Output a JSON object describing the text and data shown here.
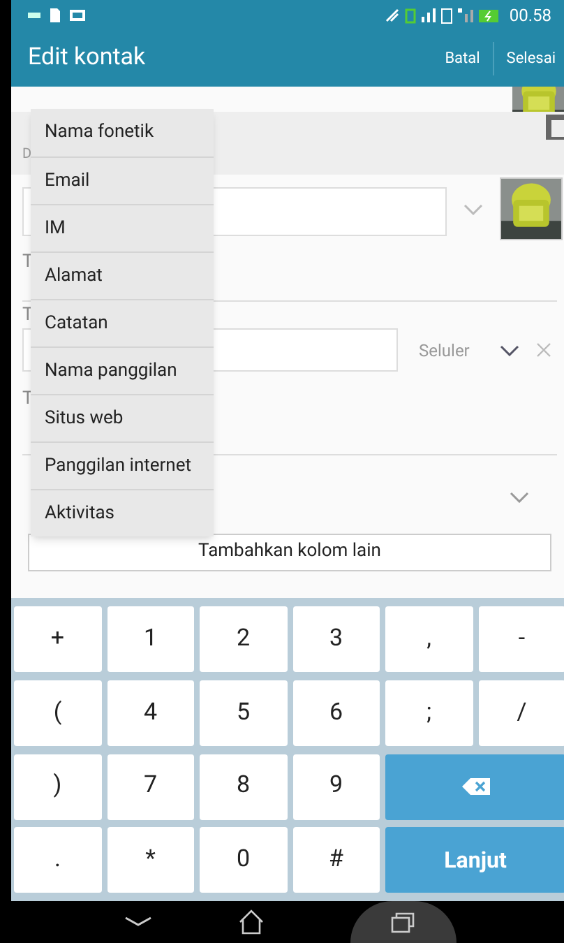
{
  "status_bar": {
    "time": "00.58"
  },
  "app_bar": {
    "title": "Edit kontak",
    "actions": [
      "Batal",
      "Selesai"
    ]
  },
  "form": {
    "name_sub": "D",
    "phone_type": "Seluler",
    "label_1": "T",
    "label_2": "T",
    "label_3": "T",
    "add_field_button": "Tambahkan kolom lain"
  },
  "menu": {
    "items": [
      "Nama fonetik",
      "Email",
      "IM",
      "Alamat",
      "Catatan",
      "Nama panggilan",
      "Situs web",
      "Panggilan internet",
      "Aktivitas"
    ]
  },
  "keyboard": {
    "keys": [
      {
        "label": "+",
        "kind": "char"
      },
      {
        "label": "1",
        "kind": "char"
      },
      {
        "label": "2",
        "kind": "char"
      },
      {
        "label": "3",
        "kind": "char"
      },
      {
        "label": ",",
        "kind": "char"
      },
      {
        "label": "-",
        "kind": "char"
      },
      {
        "label": "(",
        "kind": "char"
      },
      {
        "label": "4",
        "kind": "char"
      },
      {
        "label": "5",
        "kind": "char"
      },
      {
        "label": "6",
        "kind": "char"
      },
      {
        "label": ";",
        "kind": "char"
      },
      {
        "label": "/",
        "kind": "char"
      },
      {
        "label": ")",
        "kind": "char"
      },
      {
        "label": "7",
        "kind": "char"
      },
      {
        "label": "8",
        "kind": "char"
      },
      {
        "label": "9",
        "kind": "char"
      },
      {
        "kind": "backspace"
      },
      {
        "label": ".",
        "kind": "char"
      },
      {
        "label": "*",
        "kind": "char"
      },
      {
        "label": "0",
        "kind": "char"
      },
      {
        "label": "#",
        "kind": "char"
      },
      {
        "label": "Lanjut",
        "kind": "action"
      }
    ]
  }
}
